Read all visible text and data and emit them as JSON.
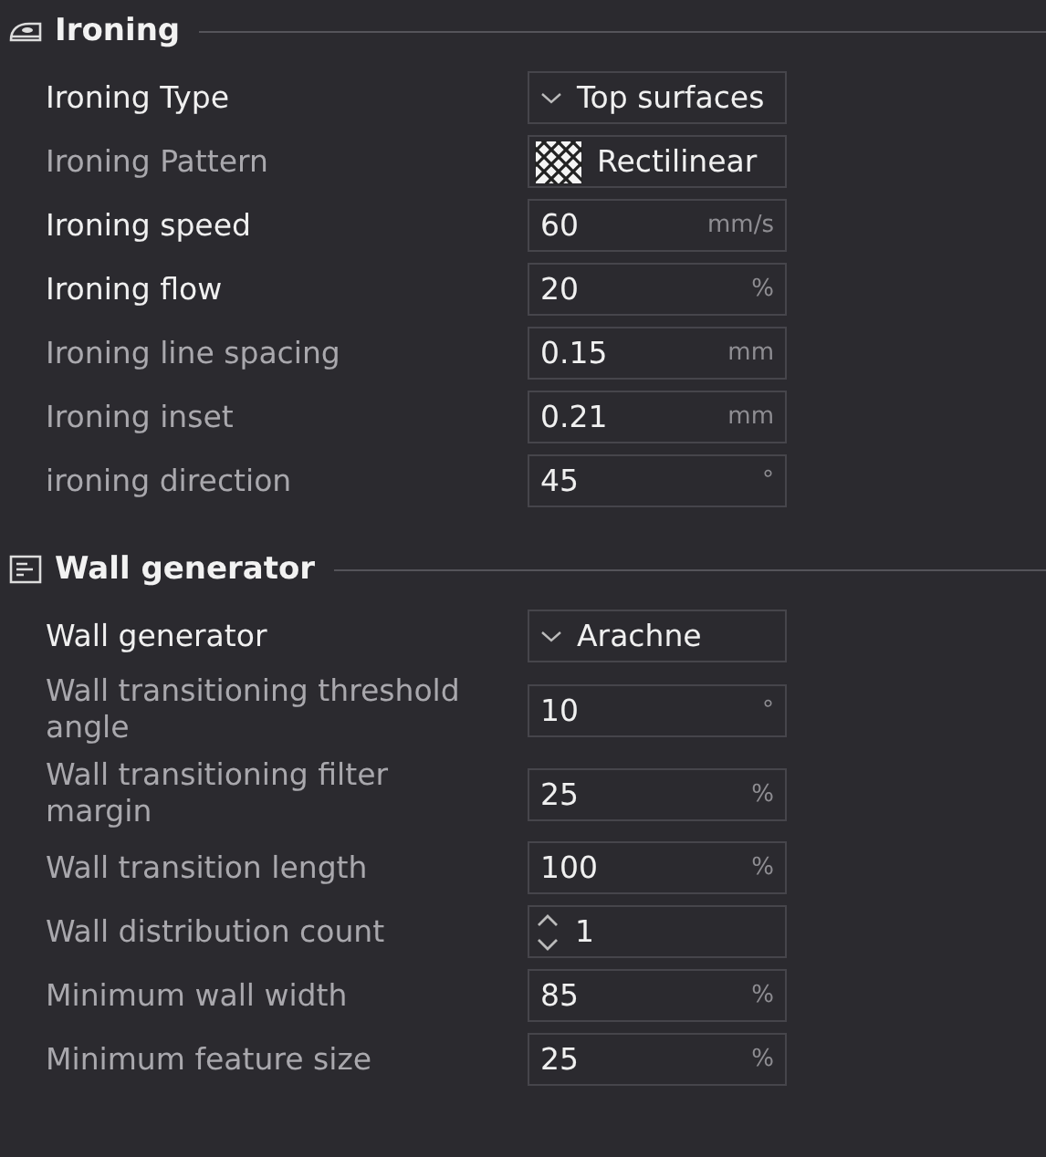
{
  "sections": [
    {
      "title": "Ironing",
      "rows": [
        {
          "label": "Ironing Type",
          "modified": true,
          "kind": "dropdown",
          "value": "Top surfaces"
        },
        {
          "label": "Ironing Pattern",
          "modified": false,
          "kind": "pattern",
          "value": "Rectilinear"
        },
        {
          "label": "Ironing speed",
          "modified": true,
          "kind": "number",
          "value": "60",
          "unit": "mm/s"
        },
        {
          "label": "Ironing flow",
          "modified": true,
          "kind": "number",
          "value": "20",
          "unit": "%"
        },
        {
          "label": "Ironing line spacing",
          "modified": false,
          "kind": "number",
          "value": "0.15",
          "unit": "mm"
        },
        {
          "label": "Ironing inset",
          "modified": false,
          "kind": "number",
          "value": "0.21",
          "unit": "mm"
        },
        {
          "label": "ironing direction",
          "modified": false,
          "kind": "number",
          "value": "45",
          "unit": "°"
        }
      ]
    },
    {
      "title": "Wall generator",
      "rows": [
        {
          "label": "Wall generator",
          "modified": true,
          "kind": "dropdown",
          "value": "Arachne"
        },
        {
          "label": "Wall transitioning threshold angle",
          "modified": false,
          "kind": "number",
          "value": "10",
          "unit": "°"
        },
        {
          "label": "Wall transitioning filter margin",
          "modified": false,
          "kind": "number",
          "value": "25",
          "unit": "%"
        },
        {
          "label": "Wall transition length",
          "modified": false,
          "kind": "number",
          "value": "100",
          "unit": "%"
        },
        {
          "label": "Wall distribution count",
          "modified": false,
          "kind": "spinner",
          "value": "1"
        },
        {
          "label": "Minimum wall width",
          "modified": false,
          "kind": "number",
          "value": "85",
          "unit": "%"
        },
        {
          "label": "Minimum feature size",
          "modified": false,
          "kind": "number",
          "value": "25",
          "unit": "%"
        }
      ]
    }
  ]
}
